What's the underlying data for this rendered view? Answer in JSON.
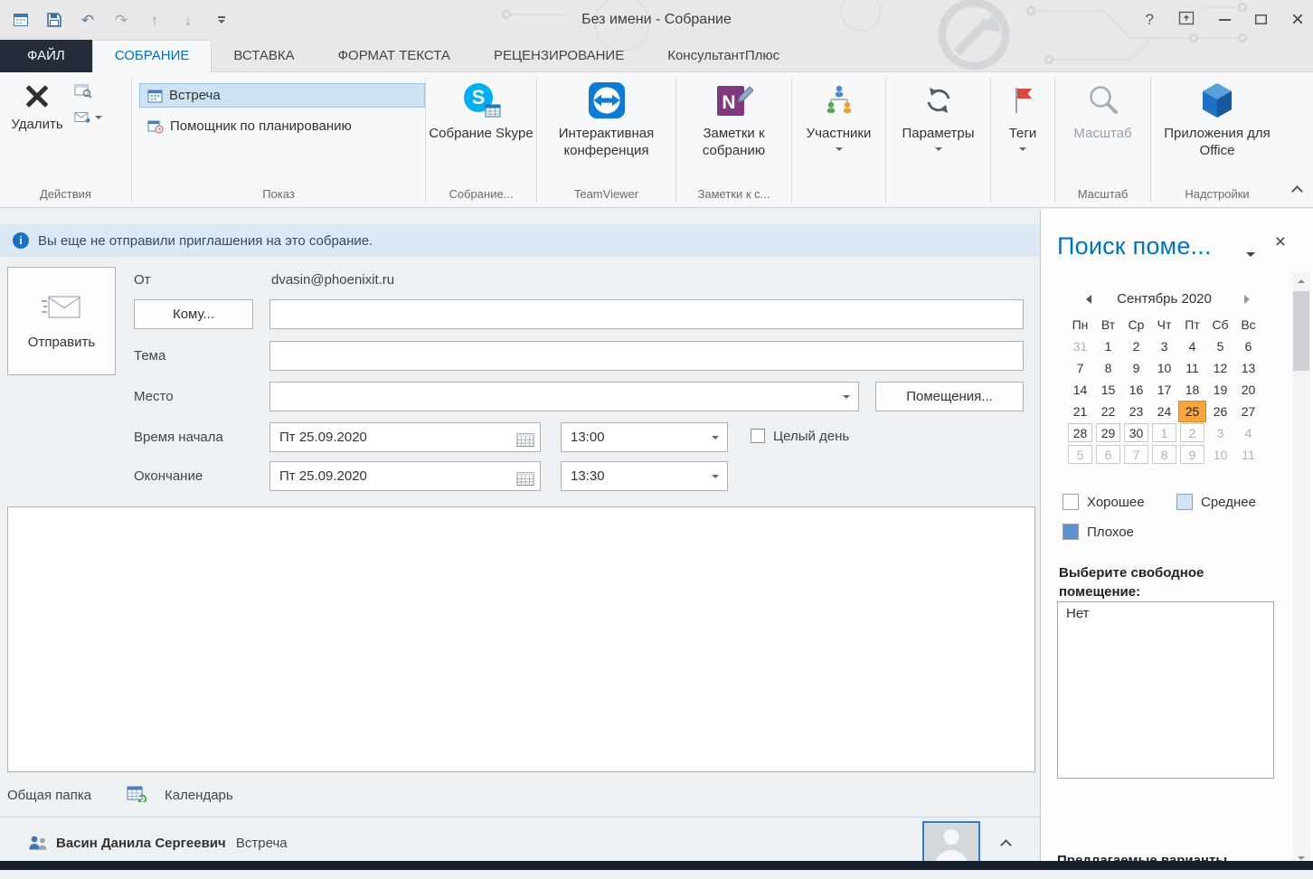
{
  "window": {
    "title": "Без имени - Собрание"
  },
  "icons": {
    "help": "?"
  },
  "colors": {
    "accent": "#0072c6",
    "selected_date": "#f6a63b"
  },
  "tabs": [
    "ФАЙЛ",
    "СОБРАНИЕ",
    "ВСТАВКА",
    "ФОРМАТ ТЕКСТА",
    "РЕЦЕНЗИРОВАНИЕ",
    "КонсультантПлюс"
  ],
  "ribbon": {
    "actions": {
      "delete": "Удалить",
      "group": "Действия"
    },
    "show": {
      "appointment": "Встреча",
      "scheduling_assistant": "Помощник по планированию",
      "group": "Показ"
    },
    "skype": {
      "button": "Собрание Skype",
      "group": "Собрание..."
    },
    "teamviewer": {
      "button": "Интерактивная конференция",
      "group": "TeamViewer"
    },
    "onenote": {
      "button": "Заметки к собранию",
      "group": "Заметки к с..."
    },
    "attendees": {
      "button": "Участники"
    },
    "options": {
      "button": "Параметры"
    },
    "tags": {
      "button": "Теги"
    },
    "zoom": {
      "button": "Масштаб",
      "group": "Масштаб"
    },
    "addins": {
      "button": "Приложения для Office",
      "group": "Надстройки"
    }
  },
  "infobar": {
    "text": "Вы еще не отправили приглашения на это собрание."
  },
  "form": {
    "send": "Отправить",
    "from_label": "От",
    "from_value": "dvasin@phoenixit.ru",
    "to_button": "Кому...",
    "to_value": "",
    "subject_label": "Тема",
    "subject_value": "",
    "location_label": "Место",
    "location_value": "",
    "rooms_button": "Помещения...",
    "start_label": "Время начала",
    "start_date": "Пт 25.09.2020",
    "start_time": "13:00",
    "all_day": "Целый день",
    "end_label": "Окончание",
    "end_date": "Пт 25.09.2020",
    "end_time": "13:30"
  },
  "footer": {
    "shared_folder": "Общая папка",
    "calendar": "Календарь"
  },
  "preview": {
    "person": "Васин Данила Сергеевич",
    "type": "Встреча"
  },
  "room_finder": {
    "title": "Поиск поме...",
    "calendar": {
      "month": "Сентябрь 2020",
      "day_headers": [
        "Пн",
        "Вт",
        "Ср",
        "Чт",
        "Пт",
        "Сб",
        "Вс"
      ],
      "weeks": [
        [
          {
            "d": 31,
            "muted": true
          },
          {
            "d": 1
          },
          {
            "d": 2
          },
          {
            "d": 3
          },
          {
            "d": 4
          },
          {
            "d": 5
          },
          {
            "d": 6
          }
        ],
        [
          {
            "d": 7
          },
          {
            "d": 8
          },
          {
            "d": 9
          },
          {
            "d": 10
          },
          {
            "d": 11
          },
          {
            "d": 12
          },
          {
            "d": 13
          }
        ],
        [
          {
            "d": 14
          },
          {
            "d": 15
          },
          {
            "d": 16
          },
          {
            "d": 17
          },
          {
            "d": 18
          },
          {
            "d": 19
          },
          {
            "d": 20
          }
        ],
        [
          {
            "d": 21
          },
          {
            "d": 22
          },
          {
            "d": 23
          },
          {
            "d": 24
          },
          {
            "d": 25,
            "selected": true
          },
          {
            "d": 26
          },
          {
            "d": 27
          }
        ],
        [
          {
            "d": 28,
            "boxed": true
          },
          {
            "d": 29,
            "boxed": true
          },
          {
            "d": 30,
            "boxed": true
          },
          {
            "d": 1,
            "muted": true,
            "boxed": true
          },
          {
            "d": 2,
            "muted": true,
            "boxed": true
          },
          {
            "d": 3,
            "muted": true
          },
          {
            "d": 4,
            "muted": true
          }
        ],
        [
          {
            "d": 5,
            "muted": true,
            "boxed": true
          },
          {
            "d": 6,
            "muted": true,
            "boxed": true
          },
          {
            "d": 7,
            "muted": true,
            "boxed": true
          },
          {
            "d": 8,
            "muted": true,
            "boxed": true
          },
          {
            "d": 9,
            "muted": true,
            "boxed": true
          },
          {
            "d": 10,
            "muted": true
          },
          {
            "d": 11,
            "muted": true
          }
        ]
      ]
    },
    "legend": [
      {
        "label": "Хорошее",
        "color": "#ffffff"
      },
      {
        "label": "Среднее",
        "color": "#cfe3f6"
      },
      {
        "label": "Плохое",
        "color": "#6290cd"
      }
    ],
    "choose_label": "Выберите свободное помещение:",
    "rooms": [
      "Нет"
    ],
    "suggested_label": "Предлагаемые варианты"
  }
}
